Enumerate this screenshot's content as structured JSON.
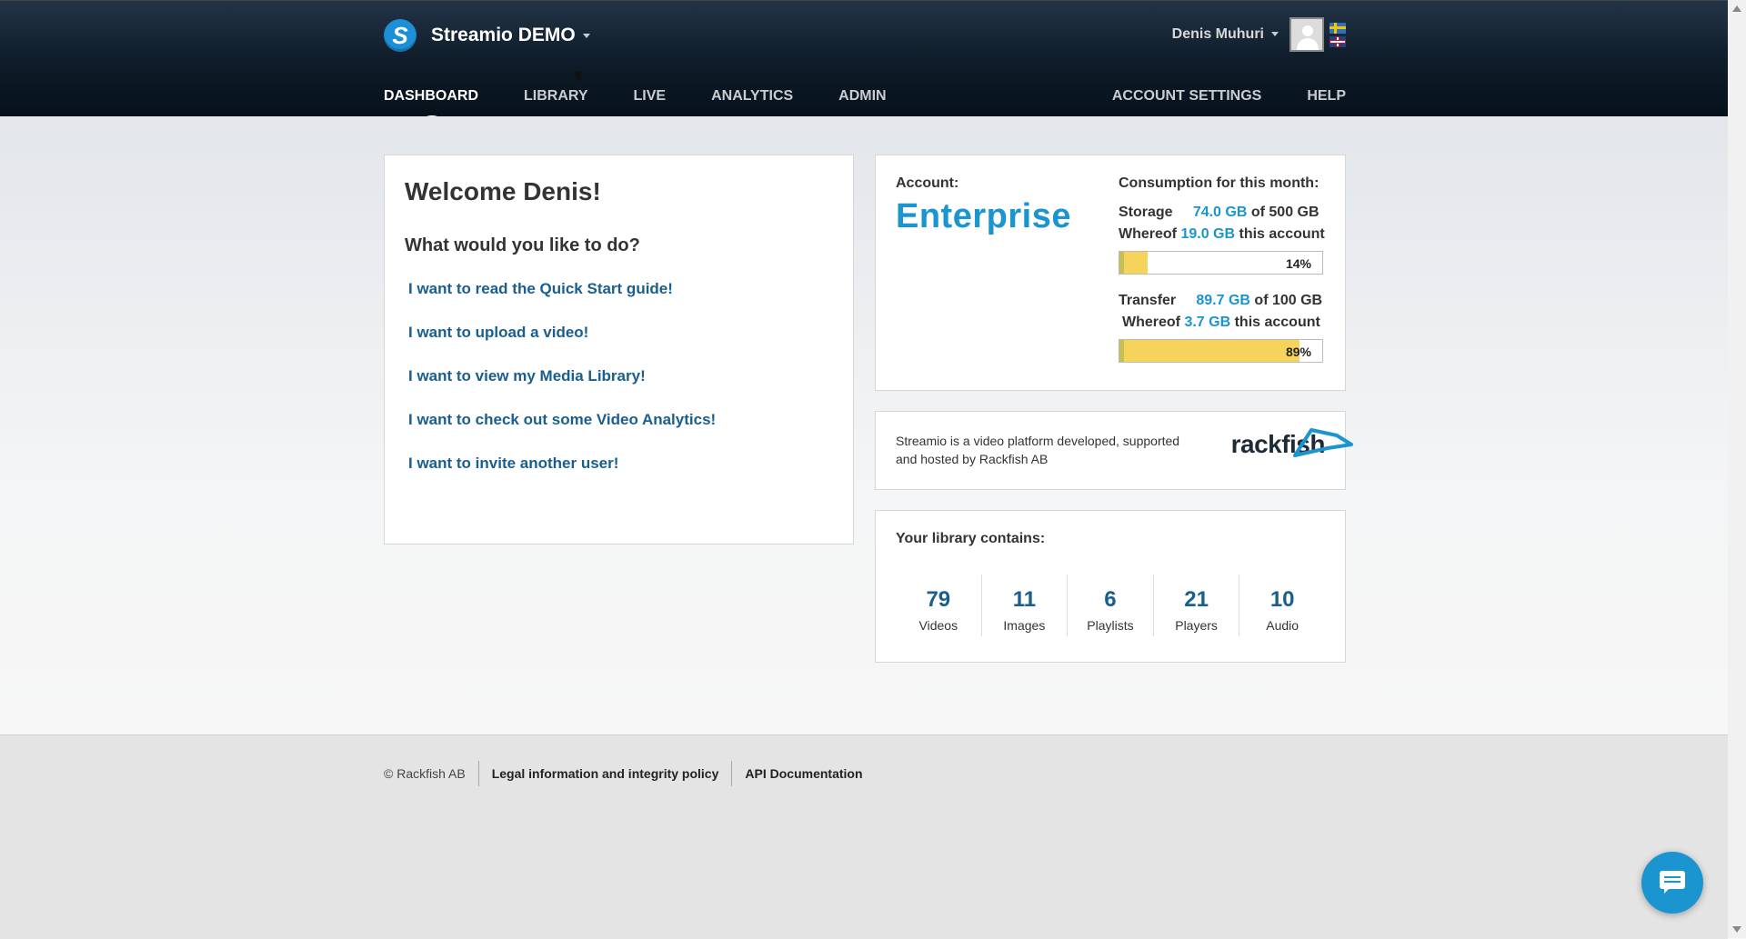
{
  "header": {
    "brand_title": "Streamio DEMO",
    "user_name": "Denis Muhuri",
    "flags": [
      "swedish-flag-icon",
      "uk-flag-icon"
    ]
  },
  "nav": {
    "left": [
      "DASHBOARD",
      "LIBRARY",
      "LIVE",
      "ANALYTICS",
      "ADMIN"
    ],
    "right": [
      "ACCOUNT SETTINGS",
      "HELP"
    ],
    "active": "DASHBOARD"
  },
  "welcome": {
    "title": "Welcome Denis!",
    "subtitle": "What would you like to do?",
    "links": [
      "I want to read the Quick Start guide!",
      "I want to upload a video!",
      "I want to view my Media Library!",
      "I want to check out some Video Analytics!",
      "I want to invite another user!"
    ]
  },
  "account": {
    "label": "Account:",
    "plan": "Enterprise",
    "consumption_label": "Consumption for this month:",
    "storage": {
      "label": "Storage",
      "used": "74.0 GB",
      "of": "of 500 GB",
      "whereof_label": "Whereof",
      "whereof": "19.0 GB",
      "whereof_suffix": "this account",
      "percent": 14,
      "percent_text": "14%"
    },
    "transfer": {
      "label": "Transfer",
      "used": "89.7 GB",
      "of": "of 100 GB",
      "whereof_label": "Whereof",
      "whereof": "3.7 GB",
      "whereof_suffix": "this account",
      "percent": 89,
      "percent_text": "89%"
    }
  },
  "about": {
    "text": "Streamio is a video platform developed, supported and hosted by Rackfish AB",
    "logo_text": "rackfish"
  },
  "library": {
    "title": "Your library contains:",
    "stats": [
      {
        "value": "79",
        "label": "Videos"
      },
      {
        "value": "11",
        "label": "Images"
      },
      {
        "value": "6",
        "label": "Playlists"
      },
      {
        "value": "21",
        "label": "Players"
      },
      {
        "value": "10",
        "label": "Audio"
      }
    ]
  },
  "footer": {
    "copyright": "© Rackfish AB",
    "links": [
      "Legal information and integrity policy",
      "API Documentation"
    ]
  },
  "colors": {
    "accent": "#1a95d0",
    "link": "#1a5e8e",
    "bar_fill": "#f6d35a"
  }
}
